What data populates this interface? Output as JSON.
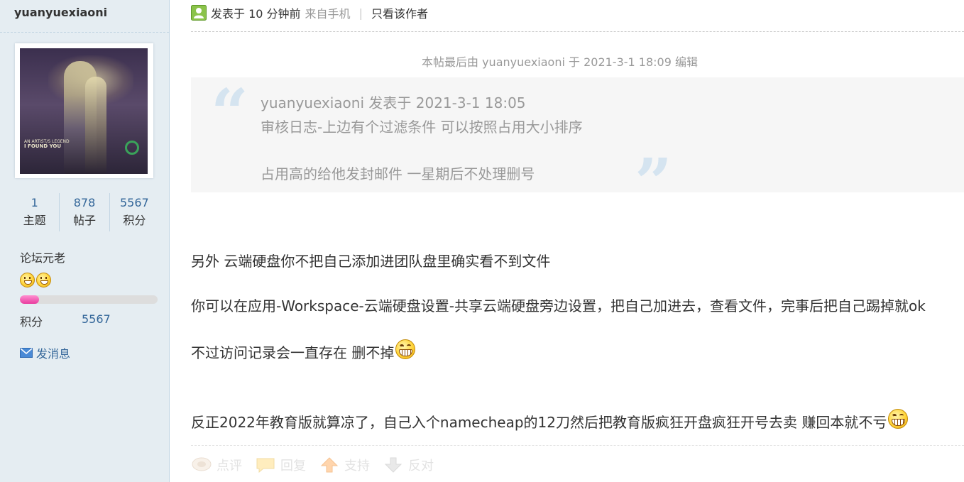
{
  "user": {
    "username": "yuanyuexiaoni",
    "avatar_text_small": "AN ARTIST/S LEGEND",
    "avatar_text_big": "I FOUND YOU",
    "stats": [
      {
        "value": "1",
        "label": "主题"
      },
      {
        "value": "878",
        "label": "帖子"
      },
      {
        "value": "5567",
        "label": "积分"
      }
    ],
    "rank_title": "论坛元老",
    "rank_progress": 0.14,
    "points_label": "积分",
    "points_value": "5567",
    "send_message": "发消息"
  },
  "post": {
    "posted_time": "发表于 10 分钟前",
    "posted_from": "来自手机",
    "separator": "|",
    "author_only": "只看该作者",
    "edit_note": "本帖最后由 yuanyuexiaoni 于 2021-3-1 18:09 编辑",
    "quote": {
      "header": "yuanyuexiaoni 发表于 2021-3-1 18:05",
      "line1": "审核日志-上边有个过滤条件 可以按照占用大小排序",
      "line2": "占用高的给他发封邮件 一星期后不处理删号"
    },
    "body": {
      "p1": "另外 云端硬盘你不把自己添加进团队盘里确实看不到文件",
      "p2": "你可以在应用-Workspace-云端硬盘设置-共享云端硬盘旁边设置，把自己加进去，查看文件，完事后把自己踢掉就ok",
      "p3": "不过访问记录会一直存在 删不掉",
      "p4": "反正2022年教育版就算凉了，自己入个namecheap的12刀然后把教育版疯狂开盘疯狂开号去卖 赚回本就不亏"
    },
    "actions": [
      {
        "icon": "comment-icon",
        "label": "点评"
      },
      {
        "icon": "reply-icon",
        "label": "回复"
      },
      {
        "icon": "support-arrow-up-icon",
        "label": "支持"
      },
      {
        "icon": "oppose-arrow-down-icon",
        "label": "反对"
      }
    ]
  },
  "colors": {
    "sidebar_bg": "#e5edf2",
    "link_blue": "#336699",
    "progress_pink": "#e83c9f",
    "quote_mark": "#d5e4f0"
  }
}
